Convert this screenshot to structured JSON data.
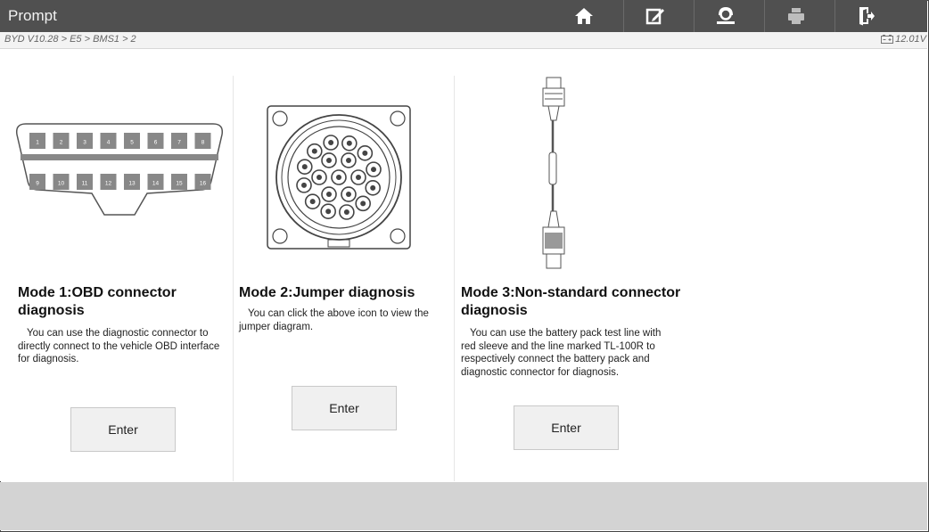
{
  "window": {
    "title": "Prompt"
  },
  "toolbar": {
    "buttons": [
      {
        "name": "home-icon"
      },
      {
        "name": "edit-report-icon"
      },
      {
        "name": "support-icon"
      },
      {
        "name": "print-icon"
      },
      {
        "name": "exit-icon"
      }
    ]
  },
  "breadcrumb": "BYD V10.28 > E5 > BMS1 > 2",
  "status": {
    "voltage": "12.01V"
  },
  "modes": [
    {
      "title": "Mode 1:OBD connector diagnosis",
      "description": "You can use the diagnostic connector to directly connect to the vehicle OBD interface for diagnosis.",
      "button": "Enter",
      "pins_top": [
        "1",
        "2",
        "3",
        "4",
        "5",
        "6",
        "7",
        "8"
      ],
      "pins_bottom": [
        "9",
        "10",
        "11",
        "12",
        "13",
        "14",
        "15",
        "16"
      ]
    },
    {
      "title": "Mode 2:Jumper diagnosis",
      "description": "You can click the above icon to view the jumper diagram.",
      "button": "Enter"
    },
    {
      "title": "Mode 3:Non-standard connector diagnosis",
      "description": "You can use the battery pack test line with red sleeve and the line marked TL-100R to respectively connect the battery pack and diagnostic connector for diagnosis.",
      "button": "Enter"
    }
  ],
  "colors": {
    "titlebar": "#505050",
    "footer": "#d3d3d3",
    "button": "#f0f0f0"
  }
}
